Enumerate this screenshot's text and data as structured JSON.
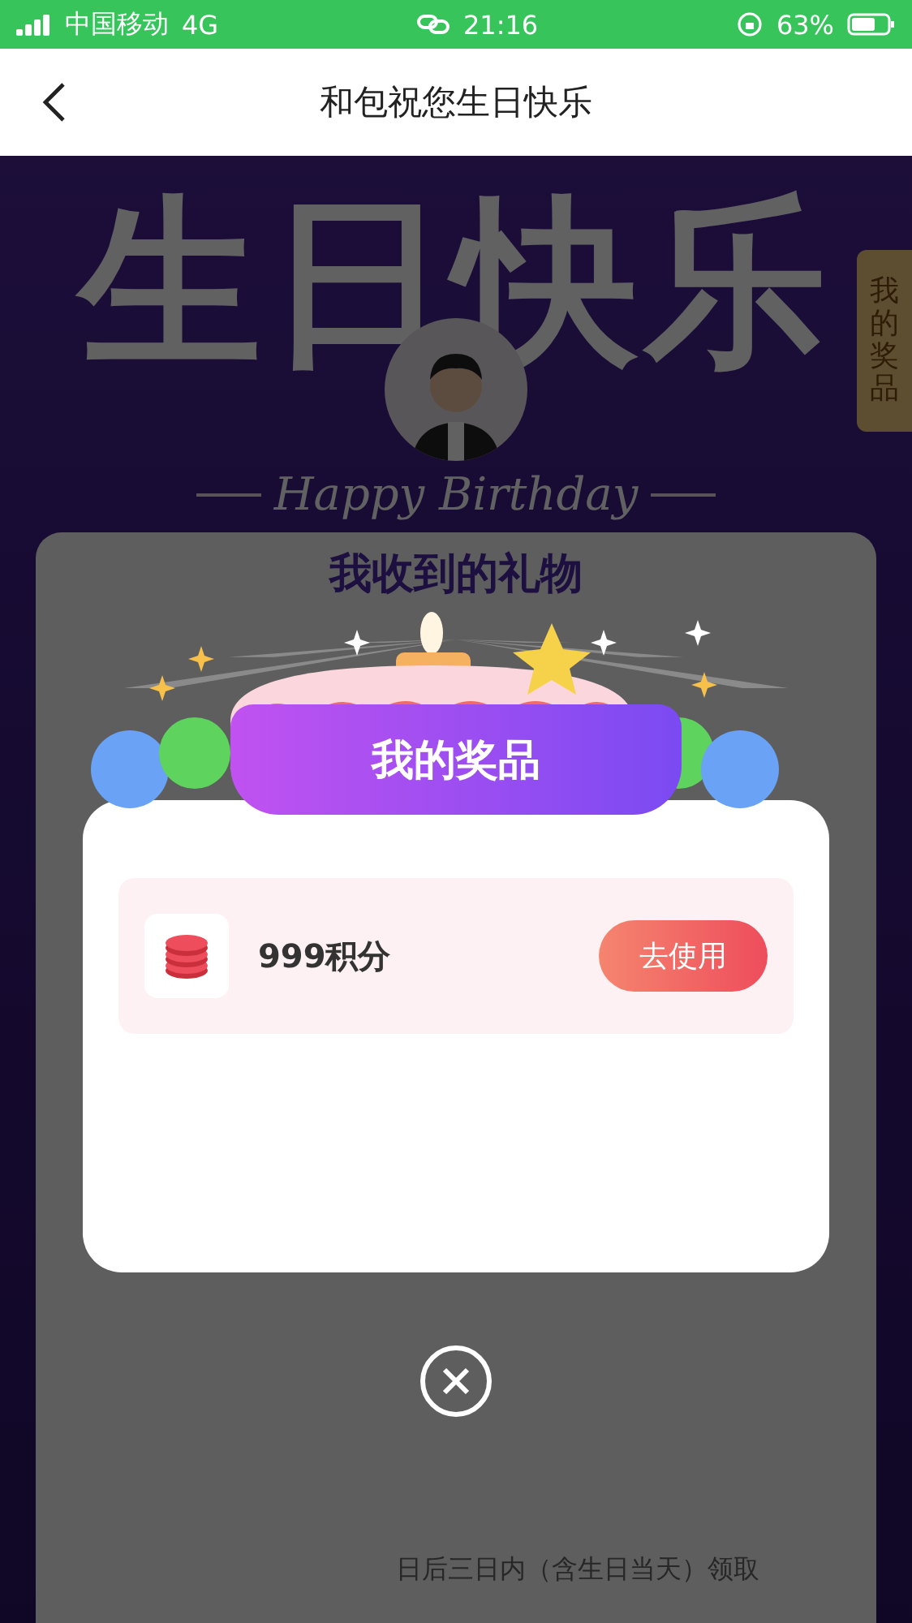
{
  "status_bar": {
    "carrier": "中国移动",
    "network": "4G",
    "time": "21:16",
    "battery": "63%"
  },
  "nav": {
    "title": "和包祝您生日快乐"
  },
  "hero": {
    "title": "生日快乐",
    "subtitle": "Happy Birthday"
  },
  "side_tab": {
    "label": "我的奖品"
  },
  "gift_card": {
    "title": "我收到的礼物",
    "note": "日后三日内（含生日当天）领取"
  },
  "prize_dialog": {
    "title": "我的奖品",
    "prizes": [
      {
        "name": "999积分",
        "action": "去使用"
      }
    ]
  }
}
